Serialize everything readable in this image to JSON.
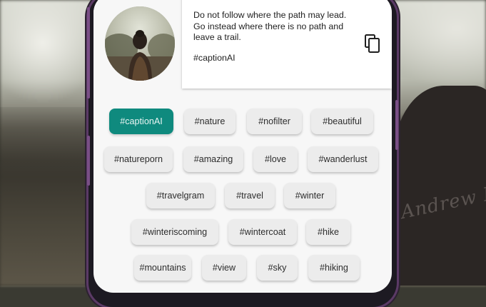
{
  "caption": {
    "text": "Do not follow where the path may lead. Go instead where there is no path and leave a trail.",
    "hashtag": "#captionAI"
  },
  "copy_icon": "copy-icon",
  "background_scribble": "Andrew Bobby",
  "colors": {
    "selected_chip": "#0f8a7e",
    "chip": "#ececec",
    "card": "#ffffff",
    "phone_frame": "#5b3a66"
  },
  "hashtags": [
    {
      "label": "#captionAI",
      "selected": true
    },
    {
      "label": "#nature",
      "selected": false
    },
    {
      "label": "#nofilter",
      "selected": false
    },
    {
      "label": "#beautiful",
      "selected": false
    },
    {
      "label": "#natureporn",
      "selected": false
    },
    {
      "label": "#amazing",
      "selected": false
    },
    {
      "label": "#love",
      "selected": false
    },
    {
      "label": "#wanderlust",
      "selected": false
    },
    {
      "label": "#travelgram",
      "selected": false
    },
    {
      "label": "#travel",
      "selected": false
    },
    {
      "label": "#winter",
      "selected": false
    },
    {
      "label": "#winteriscoming",
      "selected": false
    },
    {
      "label": "#wintercoat",
      "selected": false
    },
    {
      "label": "#hike",
      "selected": false
    },
    {
      "label": "#mountains",
      "selected": false
    },
    {
      "label": "#view",
      "selected": false
    },
    {
      "label": "#sky",
      "selected": false
    },
    {
      "label": "#hiking",
      "selected": false
    }
  ]
}
